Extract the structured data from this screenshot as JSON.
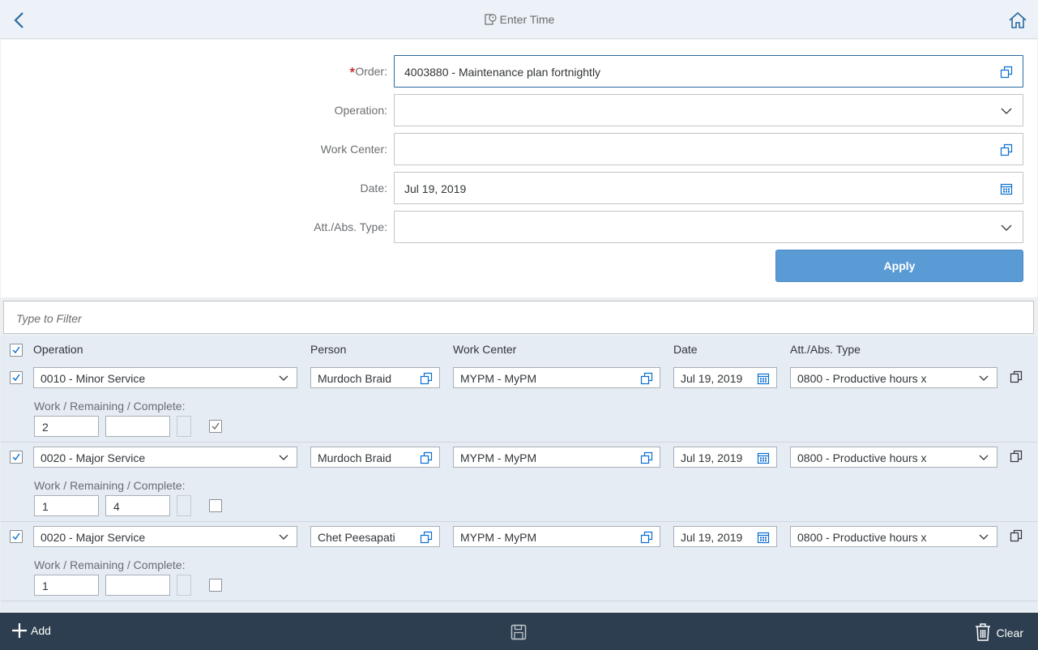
{
  "header": {
    "title": "Enter Time"
  },
  "form": {
    "order": {
      "label": "Order:",
      "required_mark": "*",
      "value": "4003880 - Maintenance plan fortnightly"
    },
    "operation": {
      "label": "Operation:",
      "value": ""
    },
    "work_center": {
      "label": "Work Center:",
      "value": ""
    },
    "date": {
      "label": "Date:",
      "value": "Jul 19, 2019"
    },
    "att_abs_type": {
      "label": "Att./Abs. Type:",
      "value": ""
    },
    "apply_label": "Apply"
  },
  "filter": {
    "placeholder": "Type to Filter"
  },
  "table": {
    "headers": {
      "operation": "Operation",
      "person": "Person",
      "work_center": "Work Center",
      "date": "Date",
      "att_abs_type": "Att./Abs. Type"
    },
    "select_all_checked": true,
    "sub_label": "Work / Remaining / Complete:",
    "rows": [
      {
        "checked": true,
        "operation": "0010 - Minor Service",
        "person": "Murdoch Braid",
        "work_center": "MYPM - MyPM",
        "date": "Jul 19, 2019",
        "att_abs_type": "0800 - Productive hours x",
        "work": "2",
        "remaining": "",
        "complete": true
      },
      {
        "checked": true,
        "operation": "0020 - Major Service",
        "person": "Murdoch Braid",
        "work_center": "MYPM - MyPM",
        "date": "Jul 19, 2019",
        "att_abs_type": "0800 - Productive hours x",
        "work": "1",
        "remaining": "4",
        "complete": false
      },
      {
        "checked": true,
        "operation": "0020 - Major Service",
        "person": "Chet Peesapati",
        "work_center": "MYPM - MyPM",
        "date": "Jul 19, 2019",
        "att_abs_type": "0800 - Productive hours x",
        "work": "1",
        "remaining": "",
        "complete": false
      }
    ]
  },
  "footer": {
    "add_label": "Add",
    "clear_label": "Clear"
  },
  "colors": {
    "accent": "#0a6ed1",
    "apply_button": "#5b9bd5",
    "footer_bg": "#2c3e50",
    "required": "#bb0000"
  },
  "icons": [
    "back-icon",
    "timesheet-icon",
    "home-icon",
    "value-help-icon",
    "chevron-down-icon",
    "calendar-icon",
    "checkbox-check-icon",
    "copy-icon",
    "add-icon",
    "save-icon",
    "delete-icon"
  ]
}
